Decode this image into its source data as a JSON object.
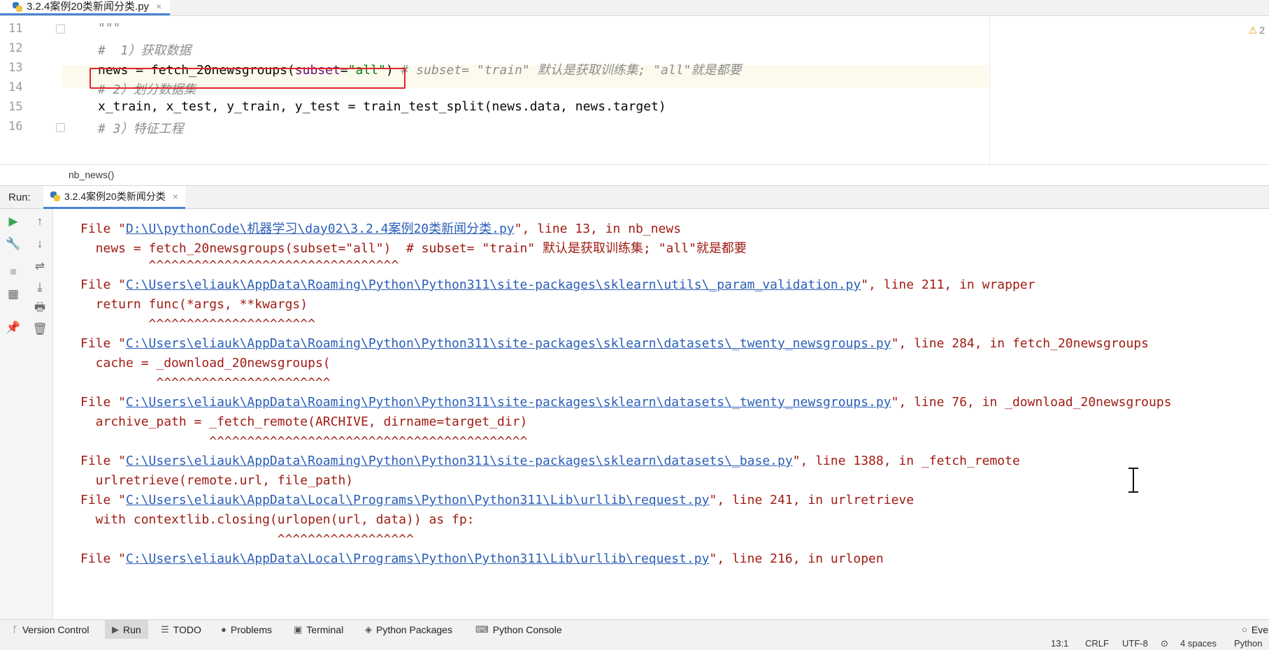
{
  "editor_tab": {
    "filename": "3.2.4案例20类新闻分类.py",
    "close": "×"
  },
  "editor": {
    "lines": [
      {
        "num": "11",
        "text": "\"\"\""
      },
      {
        "num": "12",
        "text": "#  1）获取数据"
      },
      {
        "num": "13",
        "text_parts": [
          "news = fetch_20newsgroups(",
          "subset",
          "=",
          "\"all\"",
          ")"
        ],
        "comment": " # subset= \"train\" 默认是获取训练集; \"all\"就是都要"
      },
      {
        "num": "14",
        "text": "# 2）划分数据集"
      },
      {
        "num": "15",
        "text": "x_train, x_test, y_train, y_test = train_test_split(news.data, news.target)"
      },
      {
        "num": "16",
        "text": "# 3）特征工程"
      }
    ],
    "warnings": "2",
    "warn_icon": "warning-triangle-icon"
  },
  "breadcrumb": "nb_news()",
  "run": {
    "label": "Run:",
    "tab_title": "3.2.4案例20类新闻分类",
    "tab_close": "×"
  },
  "console": {
    "lines": [
      {
        "pre": "File \"",
        "link": "D:\\U\\pythonCode\\机器学习\\day02\\3.2.4案例20类新闻分类.py",
        "post": "\", line 13, in nb_news"
      },
      {
        "text": "  news = fetch_20newsgroups(subset=\"all\")  # subset= \"train\" 默认是获取训练集; \"all\"就是都要"
      },
      {
        "text": "         ^^^^^^^^^^^^^^^^^^^^^^^^^^^^^^^^^"
      },
      {
        "pre": "File \"",
        "link": "C:\\Users\\eliauk\\AppData\\Roaming\\Python\\Python311\\site-packages\\sklearn\\utils\\_param_validation.py",
        "post": "\", line 211, in wrapper"
      },
      {
        "text": "  return func(*args, **kwargs)"
      },
      {
        "text": "         ^^^^^^^^^^^^^^^^^^^^^^"
      },
      {
        "pre": "File \"",
        "link": "C:\\Users\\eliauk\\AppData\\Roaming\\Python\\Python311\\site-packages\\sklearn\\datasets\\_twenty_newsgroups.py",
        "post": "\", line 284, in fetch_20newsgroups"
      },
      {
        "text": "  cache = _download_20newsgroups("
      },
      {
        "text": "          ^^^^^^^^^^^^^^^^^^^^^^^"
      },
      {
        "pre": "File \"",
        "link": "C:\\Users\\eliauk\\AppData\\Roaming\\Python\\Python311\\site-packages\\sklearn\\datasets\\_twenty_newsgroups.py",
        "post": "\", line 76, in _download_20newsgroups"
      },
      {
        "text": "  archive_path = _fetch_remote(ARCHIVE, dirname=target_dir)"
      },
      {
        "text": "                 ^^^^^^^^^^^^^^^^^^^^^^^^^^^^^^^^^^^^^^^^^^"
      },
      {
        "pre": "File \"",
        "link": "C:\\Users\\eliauk\\AppData\\Roaming\\Python\\Python311\\site-packages\\sklearn\\datasets\\_base.py",
        "post": "\", line 1388, in _fetch_remote"
      },
      {
        "text": "  urlretrieve(remote.url, file_path)"
      },
      {
        "pre": "File \"",
        "link": "C:\\Users\\eliauk\\AppData\\Local\\Programs\\Python\\Python311\\Lib\\urllib\\request.py",
        "post": "\", line 241, in urlretrieve"
      },
      {
        "text": "  with contextlib.closing(urlopen(url, data)) as fp:"
      },
      {
        "text": "                          ^^^^^^^^^^^^^^^^^^"
      },
      {
        "pre": "File \"",
        "link": "C:\\Users\\eliauk\\AppData\\Local\\Programs\\Python\\Python311\\Lib\\urllib\\request.py",
        "post": "\", line 216, in urlopen"
      }
    ]
  },
  "run_toolbar": {
    "col1": [
      "rerun-icon",
      "wrench-icon",
      "stop-icon",
      "layout-icon",
      "pin-icon"
    ],
    "col2": [
      "scroll-up-icon",
      "scroll-down-icon",
      "soft-wrap-icon",
      "scroll-to-end-icon",
      "print-icon",
      "trash-icon"
    ]
  },
  "bottom_tools": [
    {
      "label": "Version Control",
      "icon": "branch-icon"
    },
    {
      "label": "Run",
      "icon": "run-icon",
      "active": true
    },
    {
      "label": "TODO",
      "icon": "list-icon"
    },
    {
      "label": "Problems",
      "icon": "problems-icon"
    },
    {
      "label": "Terminal",
      "icon": "terminal-icon"
    },
    {
      "label": "Python Packages",
      "icon": "packages-icon"
    },
    {
      "label": "Python Console",
      "icon": "python-console-icon"
    }
  ],
  "bottom_right": "Eve",
  "status": {
    "position": "13:1",
    "line_sep": "CRLF",
    "encoding": "UTF-8",
    "indent": "4 spaces",
    "interpreter": "Python"
  }
}
